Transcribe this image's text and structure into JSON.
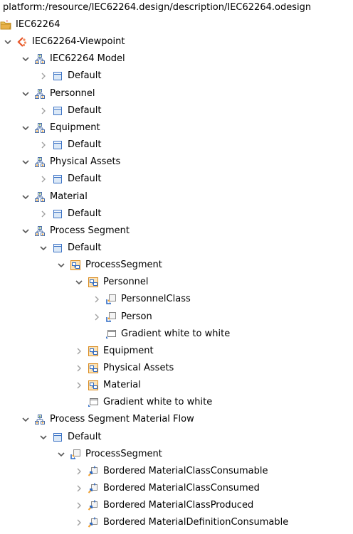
{
  "title": "platform:/resource/IEC62264.design/description/IEC62264.odesign",
  "rows": [
    {
      "label": "IEC62264",
      "icon": "project-folder-icon",
      "arrow": "none",
      "depth": 0,
      "arrowless": true
    },
    {
      "label": "IEC62264-Viewpoint",
      "icon": "viewpoint-icon",
      "arrow": "expanded",
      "depth": 0
    },
    {
      "label": "IEC62264 Model",
      "icon": "diagram-description-icon",
      "arrow": "expanded",
      "depth": 1
    },
    {
      "label": "Default",
      "icon": "layer-icon",
      "arrow": "collapsed",
      "depth": 2
    },
    {
      "label": "Personnel",
      "icon": "diagram-description-icon",
      "arrow": "expanded",
      "depth": 1
    },
    {
      "label": "Default",
      "icon": "layer-icon",
      "arrow": "collapsed",
      "depth": 2
    },
    {
      "label": "Equipment",
      "icon": "diagram-description-icon",
      "arrow": "expanded",
      "depth": 1
    },
    {
      "label": "Default",
      "icon": "layer-icon",
      "arrow": "collapsed",
      "depth": 2
    },
    {
      "label": "Physical Assets",
      "icon": "diagram-description-icon",
      "arrow": "expanded",
      "depth": 1
    },
    {
      "label": "Default",
      "icon": "layer-icon",
      "arrow": "collapsed",
      "depth": 2
    },
    {
      "label": "Material",
      "icon": "diagram-description-icon",
      "arrow": "expanded",
      "depth": 1
    },
    {
      "label": "Default",
      "icon": "layer-icon",
      "arrow": "collapsed",
      "depth": 2
    },
    {
      "label": "Process Segment",
      "icon": "diagram-description-icon",
      "arrow": "expanded",
      "depth": 1
    },
    {
      "label": "Default",
      "icon": "layer-icon",
      "arrow": "expanded",
      "depth": 2
    },
    {
      "label": "ProcessSegment",
      "icon": "container-mapping-icon",
      "arrow": "expanded",
      "depth": 3
    },
    {
      "label": "Personnel",
      "icon": "container-mapping-icon",
      "arrow": "expanded",
      "depth": 4
    },
    {
      "label": "PersonnelClass",
      "icon": "node-mapping-icon",
      "arrow": "collapsed",
      "depth": 5
    },
    {
      "label": "Person",
      "icon": "node-mapping-icon",
      "arrow": "collapsed",
      "depth": 5
    },
    {
      "label": "Gradient white to white",
      "icon": "style-icon",
      "arrow": "none",
      "depth": 5
    },
    {
      "label": "Equipment",
      "icon": "container-mapping-icon",
      "arrow": "collapsed",
      "depth": 4
    },
    {
      "label": "Physical Assets",
      "icon": "container-mapping-icon",
      "arrow": "collapsed",
      "depth": 4
    },
    {
      "label": "Material",
      "icon": "container-mapping-icon",
      "arrow": "collapsed",
      "depth": 4
    },
    {
      "label": "Gradient white to white",
      "icon": "style-icon",
      "arrow": "none",
      "depth": 4
    },
    {
      "label": "Process Segment Material Flow",
      "icon": "diagram-description-icon",
      "arrow": "expanded",
      "depth": 1
    },
    {
      "label": "Default",
      "icon": "layer-icon",
      "arrow": "expanded",
      "depth": 2
    },
    {
      "label": "ProcessSegment",
      "icon": "node-mapping-icon",
      "arrow": "expanded",
      "depth": 3
    },
    {
      "label": "Bordered MaterialClassConsumable",
      "icon": "bordered-node-icon",
      "arrow": "collapsed",
      "depth": 4
    },
    {
      "label": "Bordered MaterialClassConsumed",
      "icon": "bordered-node-icon",
      "arrow": "collapsed",
      "depth": 4
    },
    {
      "label": "Bordered MaterialClassProduced",
      "icon": "bordered-node-icon",
      "arrow": "collapsed",
      "depth": 4
    },
    {
      "label": "Bordered MaterialDefinitionConsumable",
      "icon": "bordered-node-icon",
      "arrow": "collapsed",
      "depth": 4
    }
  ],
  "colors": {
    "text": "#000000",
    "arrow": "#595959",
    "folder": "#e8b04a",
    "viewpoint": "#e8562a",
    "diagram": "#4a6ea8",
    "layer_fill": "#dce9f7",
    "layer_stroke": "#3b72c4",
    "mapping_orange": "#f0a030",
    "mapping_blue": "#2f6bc4",
    "style_gray": "#7a7a7a"
  }
}
